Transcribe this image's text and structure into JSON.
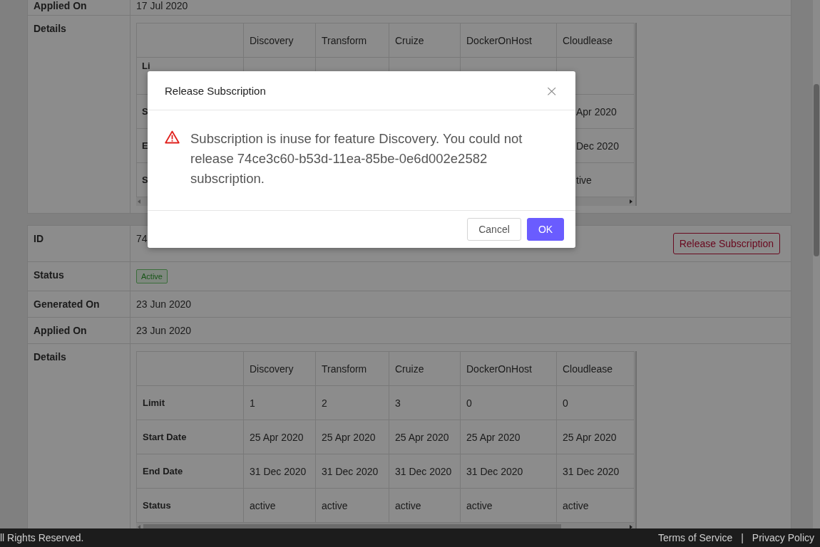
{
  "subscriptions": [
    {
      "fields": [
        {
          "kind": "text",
          "label": "Applied On",
          "value": "17 Jul 2020"
        },
        {
          "kind": "details",
          "label": "Details",
          "table": {
            "columns": [
              "Discovery",
              "Transform",
              "Cruize",
              "DockerOnHost",
              "Cloudlease"
            ],
            "rows": [
              {
                "label": "Li",
                "cells": [
                  null,
                  null,
                  null,
                  null,
                  null
                ]
              },
              {
                "label": "S",
                "cells": [
                  null,
                  null,
                  null,
                  null,
                  "Apr 2020"
                ]
              },
              {
                "label": "E",
                "cells": [
                  null,
                  null,
                  null,
                  null,
                  "Dec 2020"
                ]
              },
              {
                "label": "S",
                "cells": [
                  null,
                  null,
                  null,
                  null,
                  "tive"
                ]
              }
            ]
          }
        }
      ]
    },
    {
      "fields": [
        {
          "kind": "id",
          "label": "ID",
          "value": "74",
          "button": "Release Subscription"
        },
        {
          "kind": "badge",
          "label": "Status",
          "value": "Active"
        },
        {
          "kind": "text",
          "label": "Generated On",
          "value": "23 Jun 2020"
        },
        {
          "kind": "text",
          "label": "Applied On",
          "value": "23 Jun 2020"
        },
        {
          "kind": "details",
          "label": "Details",
          "table": {
            "columns": [
              "Discovery",
              "Transform",
              "Cruize",
              "DockerOnHost",
              "Cloudlease"
            ],
            "rows": [
              {
                "label": "Limit",
                "cells": [
                  "1",
                  "2",
                  "3",
                  "0",
                  "0"
                ]
              },
              {
                "label": "Start Date",
                "cells": [
                  "25 Apr 2020",
                  "25 Apr 2020",
                  "25 Apr 2020",
                  "25 Apr 2020",
                  "25 Apr 2020"
                ]
              },
              {
                "label": "End Date",
                "cells": [
                  "31 Dec 2020",
                  "31 Dec 2020",
                  "31 Dec 2020",
                  "31 Dec 2020",
                  "31 Dec 2020"
                ]
              },
              {
                "label": "Status",
                "cells": [
                  "active",
                  "active",
                  "active",
                  "active",
                  "active"
                ]
              }
            ]
          }
        }
      ]
    }
  ],
  "footer": {
    "copyright": "ll Rights Reserved.",
    "links": [
      "Terms of Service",
      "Privacy Policy"
    ],
    "separator": "|"
  },
  "modal": {
    "title": "Release Subscription",
    "close": "×",
    "message": "Subscription is inuse for feature Discovery. You could not release 74ce3c60-b53d-11ea-85be-0e6d002e2582 subscription.",
    "buttons": [
      {
        "label": "Cancel",
        "kind": "secondary"
      },
      {
        "label": "OK",
        "kind": "primary"
      }
    ]
  }
}
